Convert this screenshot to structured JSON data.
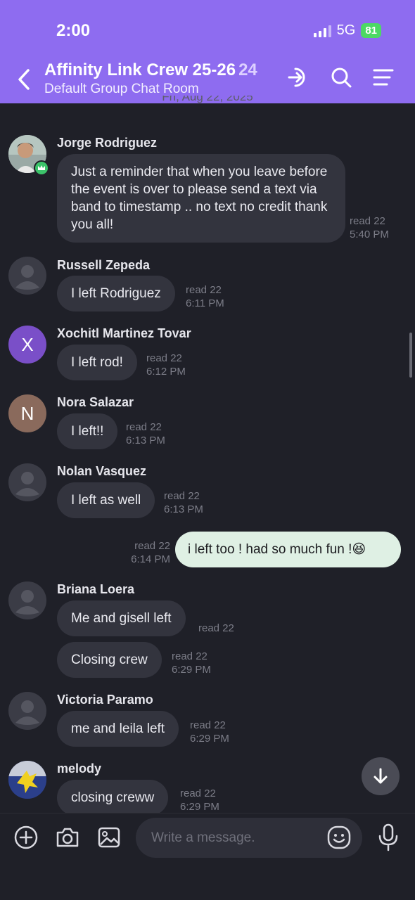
{
  "status_bar": {
    "time": "2:00",
    "network": "5G",
    "battery": "81"
  },
  "header": {
    "title": "Affinity Link Crew 25-26",
    "member_count": "24",
    "subtitle": "Default Group Chat Room"
  },
  "date_separator": "Fri, Aug 22, 2025",
  "messages": [
    {
      "sender": "Jorge Rodriguez",
      "avatar": "photo",
      "text": "Just a reminder that when you leave before the event is over to please send a text via band to timestamp .. no text no credit thank you all!",
      "read": "read 22",
      "time": "5:40 PM"
    },
    {
      "sender": "Russell Zepeda",
      "avatar": "default",
      "text": "I left Rodriguez",
      "read": "read 22",
      "time": "6:11 PM"
    },
    {
      "sender": "Xochitl Martinez Tovar",
      "avatar": "X",
      "avatar_color": "#7a4fc8",
      "text": "I left rod!",
      "read": "read 22",
      "time": "6:12 PM"
    },
    {
      "sender": "Nora Salazar",
      "avatar": "N",
      "avatar_color": "#8a6a5c",
      "text": "I left!!",
      "read": "read 22",
      "time": "6:13 PM"
    },
    {
      "sender": "Nolan Vasquez",
      "avatar": "default",
      "text": "I left as well",
      "read": "read 22",
      "time": "6:13 PM"
    },
    {
      "sender": "me",
      "text": "i left too ! had so much fun !",
      "emoji": "😆",
      "read": "read 22",
      "time": "6:14 PM"
    },
    {
      "sender": "Briana Loera",
      "avatar": "default",
      "text": "Me and gisell left",
      "read": "read 22"
    },
    {
      "sender": "Briana Loera",
      "text": "Closing crew",
      "read": "read 22",
      "time": "6:29 PM"
    },
    {
      "sender": "Victoria Paramo",
      "avatar": "default",
      "text": "me and leila left",
      "read": "read 22",
      "time": "6:29 PM"
    },
    {
      "sender": "melody",
      "avatar": "photo",
      "text": "closing creww",
      "read": "read 22",
      "time": "6:29 PM"
    }
  ],
  "composer": {
    "placeholder": "Write a message."
  },
  "colors": {
    "header": "#8e6cf0",
    "background": "#1f2028",
    "bubble": "#33343e",
    "my_bubble": "#dff0e4"
  }
}
